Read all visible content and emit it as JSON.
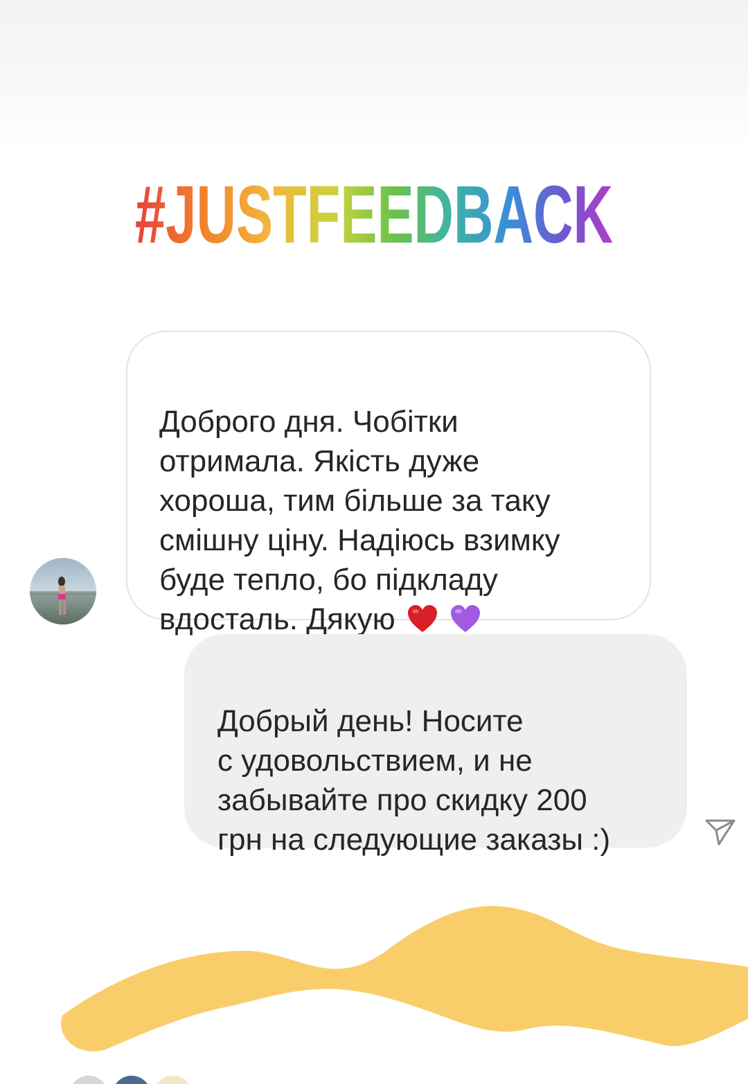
{
  "story": {
    "hashtag": "#JUSTFEEDBACK",
    "hashtag_colors": [
      "#e8413e",
      "#f0822d",
      "#f3b63c",
      "#c9d33c",
      "#6cc24a",
      "#3fb3a5",
      "#3a8fd6",
      "#6b5bd1",
      "#b03cc6"
    ]
  },
  "conversation": {
    "incoming": {
      "text": "Доброго дня. Чобітки\nотримала. Якість дуже\nхороша, тим більше за таку\nсмішну ціну. Надіюсь взимку\nбуде тепло, бо підкладу\nвдосталь. Дякую",
      "emojis": [
        "red-heart-emoji",
        "purple-heart-emoji"
      ]
    },
    "outgoing": {
      "text": "Добрый день! Носите\nс удовольствием, и не\nзабывайте про скидку 200\nгрн на следующие заказы :)"
    }
  },
  "icons": {
    "send": "send-direct-icon",
    "avatar": "user-avatar"
  },
  "colors": {
    "incoming_bubble_bg": "#ffffff",
    "incoming_bubble_border": "#e3e3e3",
    "outgoing_bubble_bg": "#efefef",
    "text": "#262626",
    "scribble": "#f9ce6a"
  }
}
